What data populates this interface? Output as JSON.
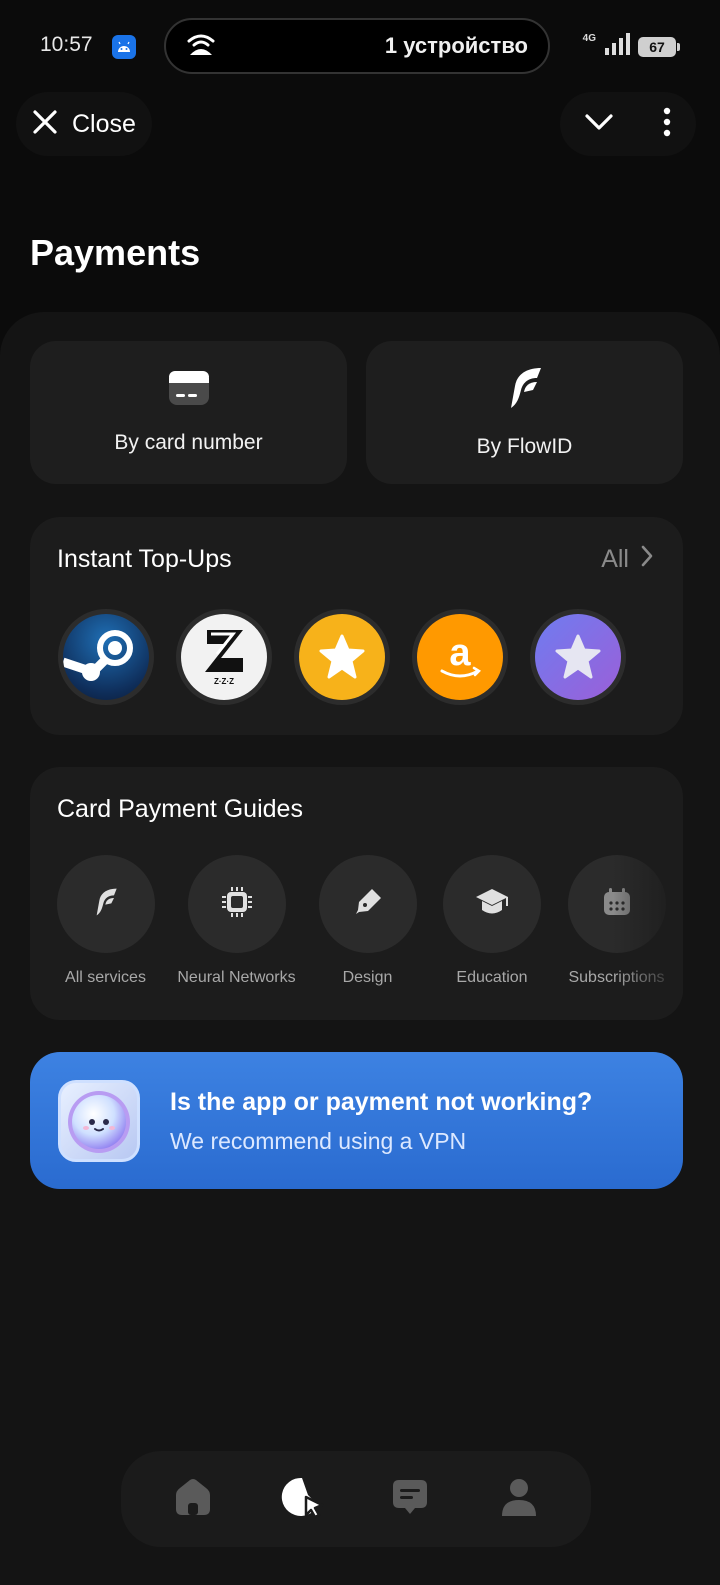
{
  "status_bar": {
    "time": "10:57",
    "hotspot_label": "1 устройство",
    "network_type": "4G",
    "battery_level": "67"
  },
  "top_bar": {
    "close_label": "Close",
    "collapse_icon": "chevron-down-icon",
    "more_icon": "more-vertical-icon"
  },
  "page": {
    "title": "Payments"
  },
  "payment_methods": [
    {
      "label": "By card number",
      "icon": "card-icon"
    },
    {
      "label": "By FlowID",
      "icon": "flowid-logo-icon"
    }
  ],
  "instant_topups": {
    "title": "Instant Top-Ups",
    "all_label": "All",
    "items": [
      {
        "name": "steam-logo-icon"
      },
      {
        "name": "zenless-zone-zero-logo-icon"
      },
      {
        "name": "star-yellow-icon"
      },
      {
        "name": "amazon-logo-icon"
      },
      {
        "name": "star-purple-icon"
      }
    ]
  },
  "guides": {
    "title": "Card Payment Guides",
    "items": [
      {
        "label": "All services",
        "icon": "flowid-logo-icon"
      },
      {
        "label": "Neural Networks",
        "icon": "chip-icon"
      },
      {
        "label": "Design",
        "icon": "pen-icon"
      },
      {
        "label": "Education",
        "icon": "graduation-cap-icon"
      },
      {
        "label": "Subscriptions",
        "icon": "calendar-icon"
      }
    ]
  },
  "banner": {
    "title": "Is the app or payment not working?",
    "subtitle": "We recommend using a VPN"
  },
  "bottom_nav": {
    "items": [
      "home-icon",
      "payments-icon",
      "chat-icon",
      "profile-icon"
    ],
    "active": "payments-icon"
  },
  "colors": {
    "background": "#0b0b0b",
    "card": "#1c1c1c",
    "accent_blue": "#3578dc",
    "yellow": "#f7b21a",
    "amazon_orange": "#ff9900"
  }
}
